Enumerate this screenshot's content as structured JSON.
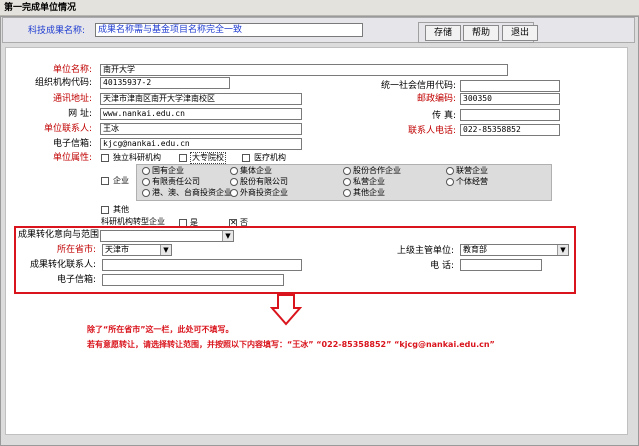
{
  "window": {
    "title": "第一完成单位情况"
  },
  "header": {
    "project_name_label": "科技成果名称:",
    "project_name_value": "成果名称需与基金项目名称完全一致",
    "buttons": {
      "save": "存储",
      "help": "帮助",
      "exit": "退出"
    }
  },
  "form": {
    "unit_name": {
      "label": "单位名称:",
      "value": "南开大学"
    },
    "org_code": {
      "label": "组织机构代码:",
      "value": "40135937-2"
    },
    "credit_code": {
      "label": "统一社会信用代码:",
      "value": ""
    },
    "address": {
      "label": "通讯地址:",
      "value": "天津市津南区南开大学津南校区"
    },
    "postcode": {
      "label": "邮政编码:",
      "value": "300350"
    },
    "website": {
      "label": "网    址:",
      "value": "www.nankai.edu.cn"
    },
    "fax": {
      "label": "传    真:",
      "value": ""
    },
    "contact": {
      "label": "单位联系人:",
      "value": "王冰"
    },
    "phone": {
      "label": "联系人电话:",
      "value": "022-85358852"
    },
    "email": {
      "label": "电子信箱:",
      "value": "kjcg@nankai.edu.cn"
    },
    "attribute": {
      "label": "单位属性:",
      "types": {
        "research": "独立科研机构",
        "university": "大专院校",
        "medical": "医疗机构",
        "enterprise": "企业",
        "other": "其他"
      },
      "enterprise_types": [
        "国有企业",
        "集体企业",
        "股份合作企业",
        "联营企业",
        "有限责任公司",
        "股份有限公司",
        "私营企业",
        "个体经营",
        "港、澳、台商投资企业",
        "外商投资企业",
        "其他企业"
      ],
      "research_transform_label": "科研机构转型企业",
      "yes": "是",
      "no": "否"
    }
  },
  "transfer": {
    "intent_label": "成果转化意向与范围:",
    "intent_value": "",
    "province_label": "所在省市:",
    "province_value": "天津市",
    "authority_label": "上级主管单位:",
    "authority_value": "教育部",
    "contact_label": "成果转化联系人:",
    "contact_value": "",
    "phone_label": "电    话:",
    "phone_value": "",
    "email_label": "电子信箱:",
    "email_value": ""
  },
  "notes": {
    "line1": "除了“所在省市”这一栏，此处可不填写。",
    "line2": "若有意愿转让，请选择转让范围，并按照以下内容填写：“王冰”  “022-85358852”  “kjcg@nankai.edu.cn”"
  },
  "colors": {
    "accent_red": "#d9141c",
    "label_red": "#c00000",
    "label_blue": "#1f3bd0"
  }
}
